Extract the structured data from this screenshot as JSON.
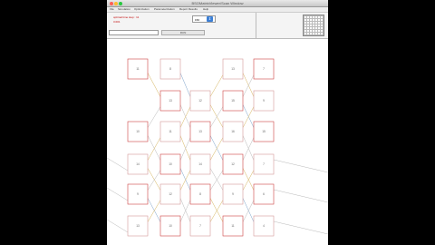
{
  "window": {
    "title": "BSOMatrixViewer/Scan Window",
    "traffic_lights": [
      "#ff5f57",
      "#febc2e",
      "#28c840"
    ]
  },
  "menus": [
    "File",
    "Simulation",
    "Optimization",
    "Parameterization",
    "Report Results",
    "Help"
  ],
  "toolbar": {
    "status_label": "optimal time step : 11",
    "status_value": "3.001",
    "zoom_value": "150",
    "run_label": "RUN"
  },
  "grid": {
    "rows": [
      [
        "11",
        "8",
        "",
        "13",
        "7"
      ],
      [
        "",
        "13",
        "12",
        "15",
        "9"
      ],
      [
        "10",
        "11",
        "13",
        "16",
        "15"
      ],
      [
        "14",
        "10",
        "14",
        "12",
        "7"
      ],
      [
        "9",
        "12",
        "8",
        "9",
        "6"
      ],
      [
        "13",
        "10",
        "7",
        "11",
        "4"
      ]
    ]
  }
}
